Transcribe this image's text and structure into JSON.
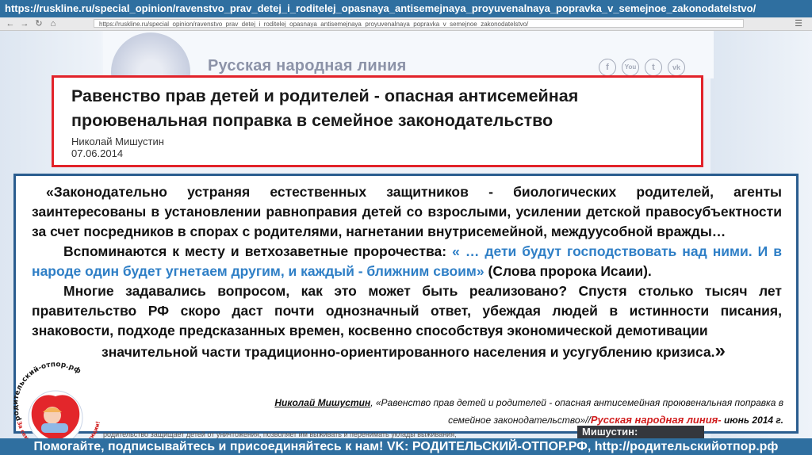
{
  "top_url": "https://ruskline.ru/special_opinion/ravenstvo_prav_detej_i_roditelej_opasnaya_antisemejnaya_proyuvenalnaya_popravka_v_semejnoe_zakonodatelstvo/",
  "browser": {
    "address": "https://ruskline.ru/special_opinion/ravenstvo_prav_detej_i_roditelej_opasnaya_antisemejnaya_proyuvenalnaya_popravka_v_semejnoe_zakonodatelstvo/"
  },
  "site": {
    "name": "Русская народная линия",
    "social": [
      "f",
      "You",
      "t",
      "vk"
    ]
  },
  "article": {
    "title": "Равенство прав детей и родителей - опасная антисемейная проювенальная поправка в семейное законодательство",
    "author": "Николай Мишустин",
    "date": "07.06.2014"
  },
  "quote": {
    "p1": "«Законодательно устраняя  естественных защитников - биологических родителей, агенты заинтересованы в установлении равноправия детей со взрослыми, усилении детской правосубъектности за счет посредников в спорах с родителями, нагнетании внутрисемейной, междуусобной вражды…",
    "p2_start": "Вспоминаются к месту и ветхозаветные пророчества: ",
    "p2_quote": "« … дети будут господствовать над ними. И в народе один будет угнетаем другим, и каждый - ближним своим»",
    "p2_end": " (Слова пророка Исаии).",
    "p3": "Многие задавались вопросом, как это может быть  реализовано? Спустя столько тысяч лет правительство РФ скоро даст почти однозначный ответ, убеждая людей в истинности писания, знаковости, подходе предсказанных  времен, косвенно способствуя экономической демотивации",
    "p3_last": "значительной части традиционно-ориентированного населения и усугублению кризиса.",
    "close_mark": "»"
  },
  "citation": {
    "author": "Николай Мишустин",
    "text": ", «Равенство прав детей и родителей - опасная антисемейная проювенальная поправка в семейное законодательство»//",
    "source": "Русская народная линия-",
    "date": " июнь 2014 г."
  },
  "background_snippet": "родительство защищает детей от уничтожения, позволяет им выживать и перенимать уклады выживания,",
  "background_label": "Мишустин:",
  "logo": {
    "ring_text": "родительский-отпор.рф",
    "lower_text": "За семью! За родину! За традиции!"
  },
  "bottom_bar": "Помогайте, подписывайтесь и присоединяйтесь к нам! VK: РОДИТЕЛЬСКИЙ-ОТПОР.РФ, http://родительскийотпор.рф",
  "colors": {
    "banner_blue": "#2f6fa0",
    "title_border_red": "#e2232a",
    "quote_border_blue": "#2a5d8f",
    "scripture_blue": "#2f7fc6",
    "source_red": "#d11e1e"
  }
}
